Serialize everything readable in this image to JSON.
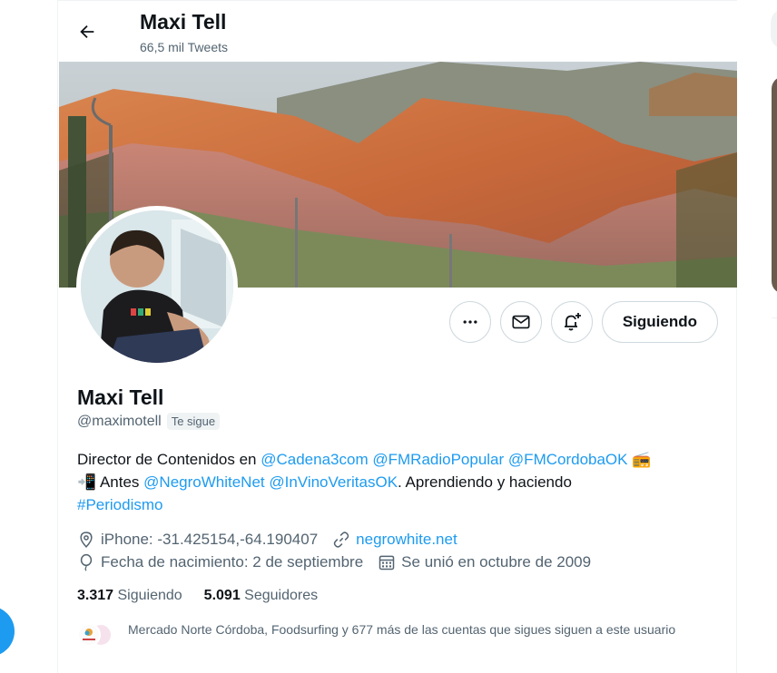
{
  "header": {
    "title": "Maxi Tell",
    "tweet_count": "66,5 mil Tweets"
  },
  "profile": {
    "name": "Maxi Tell",
    "handle": "@maximotell",
    "follows_you": "Te sigue",
    "bio": {
      "part1": "Director de Contenidos en ",
      "mention1": "@Cadena3com",
      "mention2": "@FMRadioPopular",
      "mention3": "@FMCordobaOK",
      "emoji1": "📻",
      "emoji2": "📲",
      "part2": " Antes ",
      "mention4": "@NegroWhiteNet",
      "mention5": "@InVinoVeritasOK",
      "part3": ". Aprendiendo y haciendo ",
      "hashtag": "#Periodismo"
    },
    "location": "iPhone: -31.425154,-64.190407",
    "website": "negrowhite.net",
    "birthday": "Fecha de nacimiento: 2 de septiembre",
    "joined": "Se unió en octubre de 2009"
  },
  "actions": {
    "more_icon": "more-dots-icon",
    "message_icon": "envelope-icon",
    "notify_icon": "bell-plus-icon",
    "follow_label": "Siguiendo"
  },
  "counts": {
    "following_value": "3.317",
    "following_label": "Siguiendo",
    "followers_value": "5.091",
    "followers_label": "Seguidores"
  },
  "mutual": {
    "text": "Mercado Norte Córdoba, Foodsurfing y 677 más de las cuentas que sigues siguen a este usuario"
  },
  "colors": {
    "accent": "#1d9bf0",
    "text": "#0f1419",
    "secondary": "#536471",
    "border": "#cfd9de"
  }
}
